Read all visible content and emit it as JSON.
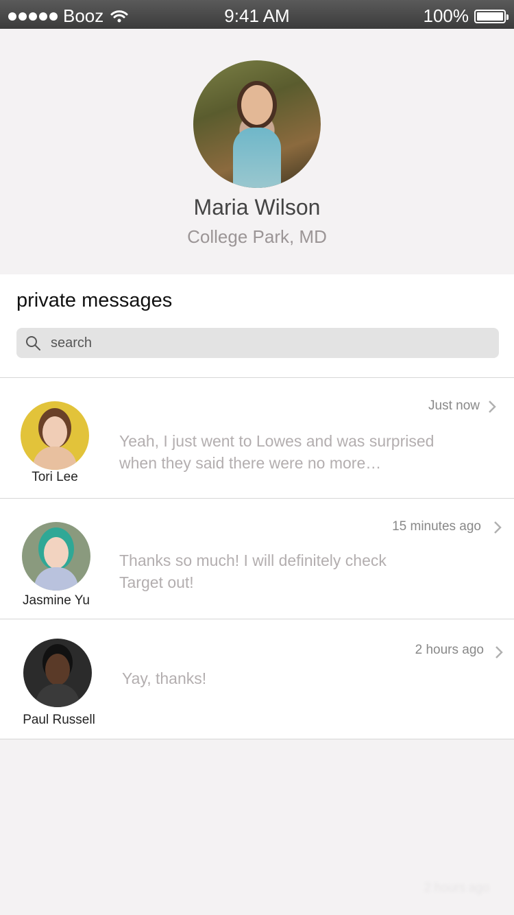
{
  "status_bar": {
    "carrier": "Booz",
    "time": "9:41 AM",
    "battery": "100%",
    "signal_icon": "signal-dots-icon",
    "wifi_icon": "wifi-icon",
    "battery_icon": "battery-icon"
  },
  "profile": {
    "name": "Maria Wilson",
    "location": "College Park, MD",
    "avatar_icon": "profile-photo"
  },
  "messages": {
    "title": "private messages",
    "search_placeholder": "search",
    "items": [
      {
        "name": "Tori Lee",
        "time": "Just now",
        "preview": "Yeah, I just went to Lowes and was surprised when they said there were no more…",
        "avatar_bg": "#e2c33a",
        "face_color": "#f0cdb6",
        "hair_color": "#6a4128",
        "torso_color": "#e8c09f"
      },
      {
        "name": "Jasmine Yu",
        "time": "15 minutes ago",
        "preview": "Thanks so much! I will definitely check Target out!",
        "avatar_bg": "#8a9a7e",
        "face_color": "#f2d3c0",
        "hair_color": "#2fa896",
        "torso_color": "#b9c2dd"
      },
      {
        "name": "Paul Russell",
        "time": "2 hours ago",
        "preview": "Yay, thanks!",
        "avatar_bg": "#2b2b2b",
        "face_color": "#5a3a28",
        "hair_color": "#111111",
        "torso_color": "#3a3a3a"
      }
    ]
  },
  "footer_ghost": "2 hours ago"
}
